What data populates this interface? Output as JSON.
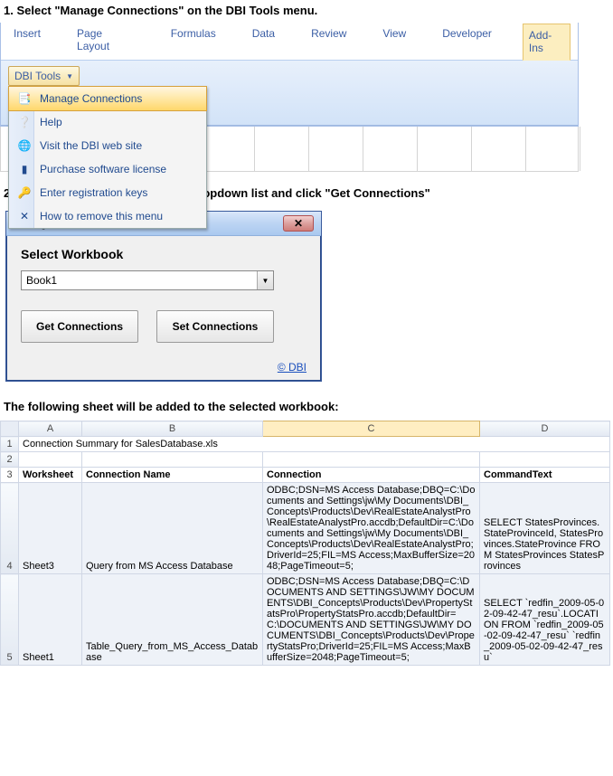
{
  "step1": "1. Select \"Manage Connections\" on the DBI Tools menu.",
  "step2": "2. Select the workbooks from the dropdown list and click \"Get Connections\"",
  "followText": "The following sheet will be added to the selected workbook:",
  "ribbon": {
    "tabs": [
      "Insert",
      "Page Layout",
      "Formulas",
      "Data",
      "Review",
      "View",
      "Developer",
      "Add-Ins"
    ],
    "active": "Add-Ins",
    "dbi_btn": "DBI Tools",
    "menu": [
      {
        "icon": "📑",
        "label": "Manage Connections",
        "sel": true
      },
      {
        "icon": "❔",
        "label": "Help"
      },
      {
        "icon": "🌐",
        "label": "Visit the DBI web site"
      },
      {
        "icon": "▮",
        "label": "Purchase software license"
      },
      {
        "icon": "🔑",
        "label": "Enter registration keys"
      },
      {
        "icon": "✕",
        "label": "How to remove this menu"
      }
    ]
  },
  "dialog": {
    "title": "Manage Connections",
    "heading": "Select Workbook",
    "combo_value": "Book1",
    "btn_get": "Get Connections",
    "btn_set": "Set Connections",
    "link": "© DBI"
  },
  "sheet": {
    "cols": [
      "A",
      "B",
      "C",
      "D"
    ],
    "sel_col": "C",
    "row1": "Connection Summary for SalesDatabase.xls",
    "hdr": {
      "A": "Worksheet",
      "B": "Connection Name",
      "C": "Connection",
      "D": "CommandText"
    },
    "rows": [
      {
        "n": "4",
        "A": "Sheet3",
        "B": "Query from MS Access Database",
        "C": "ODBC;DSN=MS Access Database;DBQ=C:\\Documents and Settings\\jw\\My Documents\\DBI_Concepts\\Products\\Dev\\RealEstateAnalystPro\\RealEstateAnalystPro.accdb;DefaultDir=C:\\Documents and Settings\\jw\\My Documents\\DBI_Concepts\\Products\\Dev\\RealEstateAnalystPro;DriverId=25;FIL=MS Access;MaxBufferSize=2048;PageTimeout=5;",
        "D": "SELECT StatesProvinces.StateProvinceId, StatesProvinces.StateProvince FROM StatesProvinces StatesProvinces"
      },
      {
        "n": "5",
        "A": "Sheet1",
        "B": "Table_Query_from_MS_Access_Database",
        "C": "ODBC;DSN=MS Access Database;DBQ=C:\\DOCUMENTS AND SETTINGS\\JW\\MY DOCUMENTS\\DBI_Concepts\\Products\\Dev\\PropertyStatsPro\\PropertyStatsPro.accdb;DefaultDir=C:\\DOCUMENTS AND SETTINGS\\JW\\MY DOCUMENTS\\DBI_Concepts\\Products\\Dev\\PropertyStatsPro;DriverId=25;FIL=MS Access;MaxBufferSize=2048;PageTimeout=5;",
        "D": "SELECT `redfin_2009-05-02-09-42-47_resu`.LOCATION FROM `redfin_2009-05-02-09-42-47_resu` `redfin_2009-05-02-09-42-47_resu`"
      }
    ]
  }
}
